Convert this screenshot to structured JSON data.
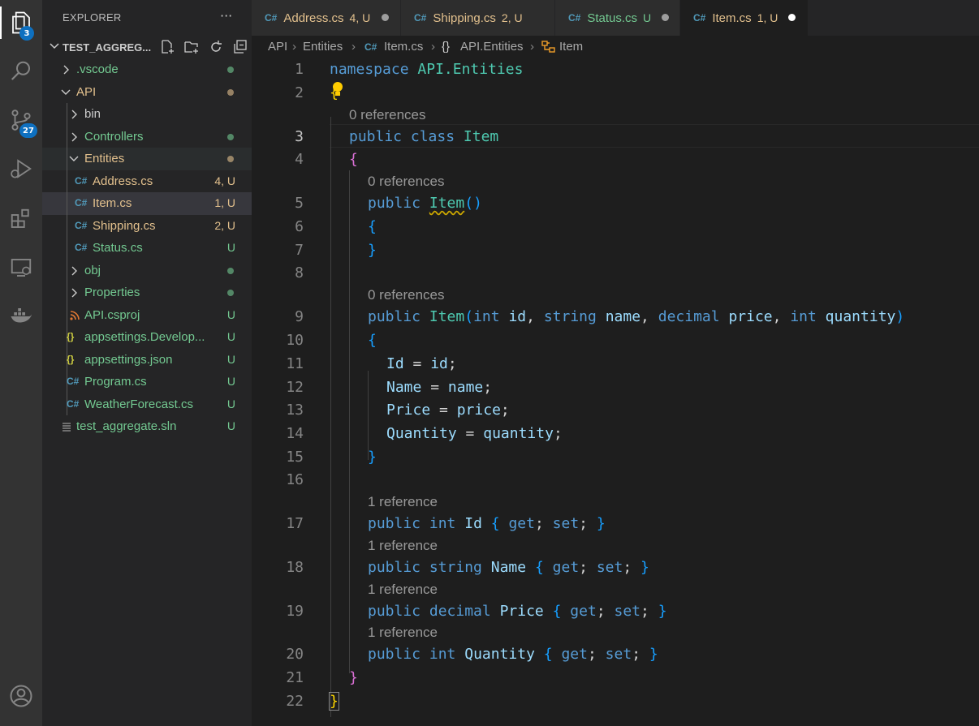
{
  "activity_bar": {
    "explorer_badge": "3",
    "source_control_badge": "27"
  },
  "sidebar": {
    "title": "EXPLORER",
    "more": "···",
    "workspace": "TEST_AGGREG...",
    "tree": [
      {
        "label": ".vscode",
        "status": "",
        "kind": "folder",
        "state": "collapsed"
      },
      {
        "label": "API",
        "status": "",
        "kind": "folder",
        "state": "expanded"
      },
      {
        "label": "bin",
        "status": "",
        "kind": "folder",
        "state": "collapsed"
      },
      {
        "label": "Controllers",
        "status": "",
        "kind": "folder",
        "state": "collapsed"
      },
      {
        "label": "Entities",
        "status": "",
        "kind": "folder",
        "state": "expanded"
      },
      {
        "label": "Address.cs",
        "status": "4, U",
        "kind": "cs"
      },
      {
        "label": "Item.cs",
        "status": "1, U",
        "kind": "cs"
      },
      {
        "label": "Shipping.cs",
        "status": "2, U",
        "kind": "cs"
      },
      {
        "label": "Status.cs",
        "status": "U",
        "kind": "cs"
      },
      {
        "label": "obj",
        "status": "",
        "kind": "folder",
        "state": "collapsed"
      },
      {
        "label": "Properties",
        "status": "",
        "kind": "folder",
        "state": "collapsed"
      },
      {
        "label": "API.csproj",
        "status": "U",
        "kind": "rss"
      },
      {
        "label": "appsettings.Develop...",
        "status": "U",
        "kind": "json"
      },
      {
        "label": "appsettings.json",
        "status": "U",
        "kind": "json"
      },
      {
        "label": "Program.cs",
        "status": "U",
        "kind": "cs"
      },
      {
        "label": "WeatherForecast.cs",
        "status": "U",
        "kind": "cs"
      },
      {
        "label": "test_aggregate.sln",
        "status": "U",
        "kind": "sln"
      }
    ]
  },
  "tabs": [
    {
      "name": "Address.cs",
      "status": "4, U",
      "active": false
    },
    {
      "name": "Shipping.cs",
      "status": "2, U",
      "active": false
    },
    {
      "name": "Status.cs",
      "status": "U",
      "active": false
    },
    {
      "name": "Item.cs",
      "status": "1, U",
      "active": true
    }
  ],
  "breadcrumb": [
    "API",
    "Entities",
    "Item.cs",
    "API.Entities",
    "Item"
  ],
  "editor": {
    "line_numbers": [
      "1",
      "2",
      "3",
      "4",
      "5",
      "6",
      "7",
      "8",
      "9",
      "10",
      "11",
      "12",
      "13",
      "14",
      "15",
      "16",
      "17",
      "18",
      "19",
      "20",
      "21",
      "22"
    ],
    "code_lens": {
      "class_refs": "0 references",
      "ctor1_refs": "0 references",
      "ctor2_refs": "0 references",
      "id_refs": "1 reference",
      "name_refs": "1 reference",
      "price_refs": "1 reference",
      "quantity_refs": "1 reference"
    },
    "code": {
      "l1_kw": "namespace",
      "l1_ns": "API.Entities",
      "open_brace": "{",
      "close_brace": "}",
      "public": "public",
      "class": "class",
      "class_name": "Item",
      "ctor_name": "Item",
      "paren_open": "(",
      "paren_close": ")",
      "int": "int",
      "string": "string",
      "decimal": "decimal",
      "p_id": "id",
      "p_name": "name",
      "p_price": "price",
      "p_quantity": "quantity",
      "comma": ",",
      "semi": ";",
      "eq": "=",
      "Id": "Id",
      "Name": "Name",
      "Price": "Price",
      "Quantity": "Quantity",
      "get": "get",
      "set": "set"
    }
  },
  "colors": {
    "accent_badge": "#0e70c0",
    "untracked": "#73c991",
    "modified": "#e2c08d",
    "keyword": "#569cd6",
    "type": "#4ec9b0",
    "identifier": "#9cdcfe"
  }
}
